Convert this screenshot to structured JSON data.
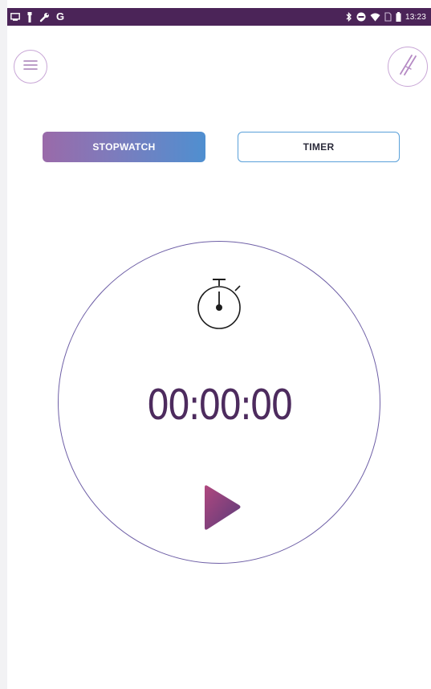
{
  "status_bar": {
    "left_letter": "G",
    "time": "13:23",
    "icons_left": [
      "screen-icon",
      "usb-icon",
      "wrench-icon",
      "g-letter"
    ],
    "icons_right": [
      "bluetooth-icon",
      "do-not-disturb-icon",
      "wifi-icon",
      "no-sim-icon",
      "battery-icon"
    ]
  },
  "header": {
    "menu_icon": "menu-icon",
    "logo_icon": "app-logo-icon"
  },
  "tabs": {
    "stopwatch_label": "STOPWATCH",
    "timer_label": "TIMER",
    "active": "stopwatch"
  },
  "stopwatch": {
    "time": "00:00:00",
    "icon": "stopwatch-icon",
    "play_icon": "play-icon"
  },
  "colors": {
    "status_bar": "#4b2458",
    "time_text": "#4d2b5e",
    "dial_border": "#6e5fa6",
    "tab_gradient_start": "#9a6aa9",
    "tab_gradient_end": "#4f8fd0",
    "timer_border": "#5aa0d9"
  }
}
